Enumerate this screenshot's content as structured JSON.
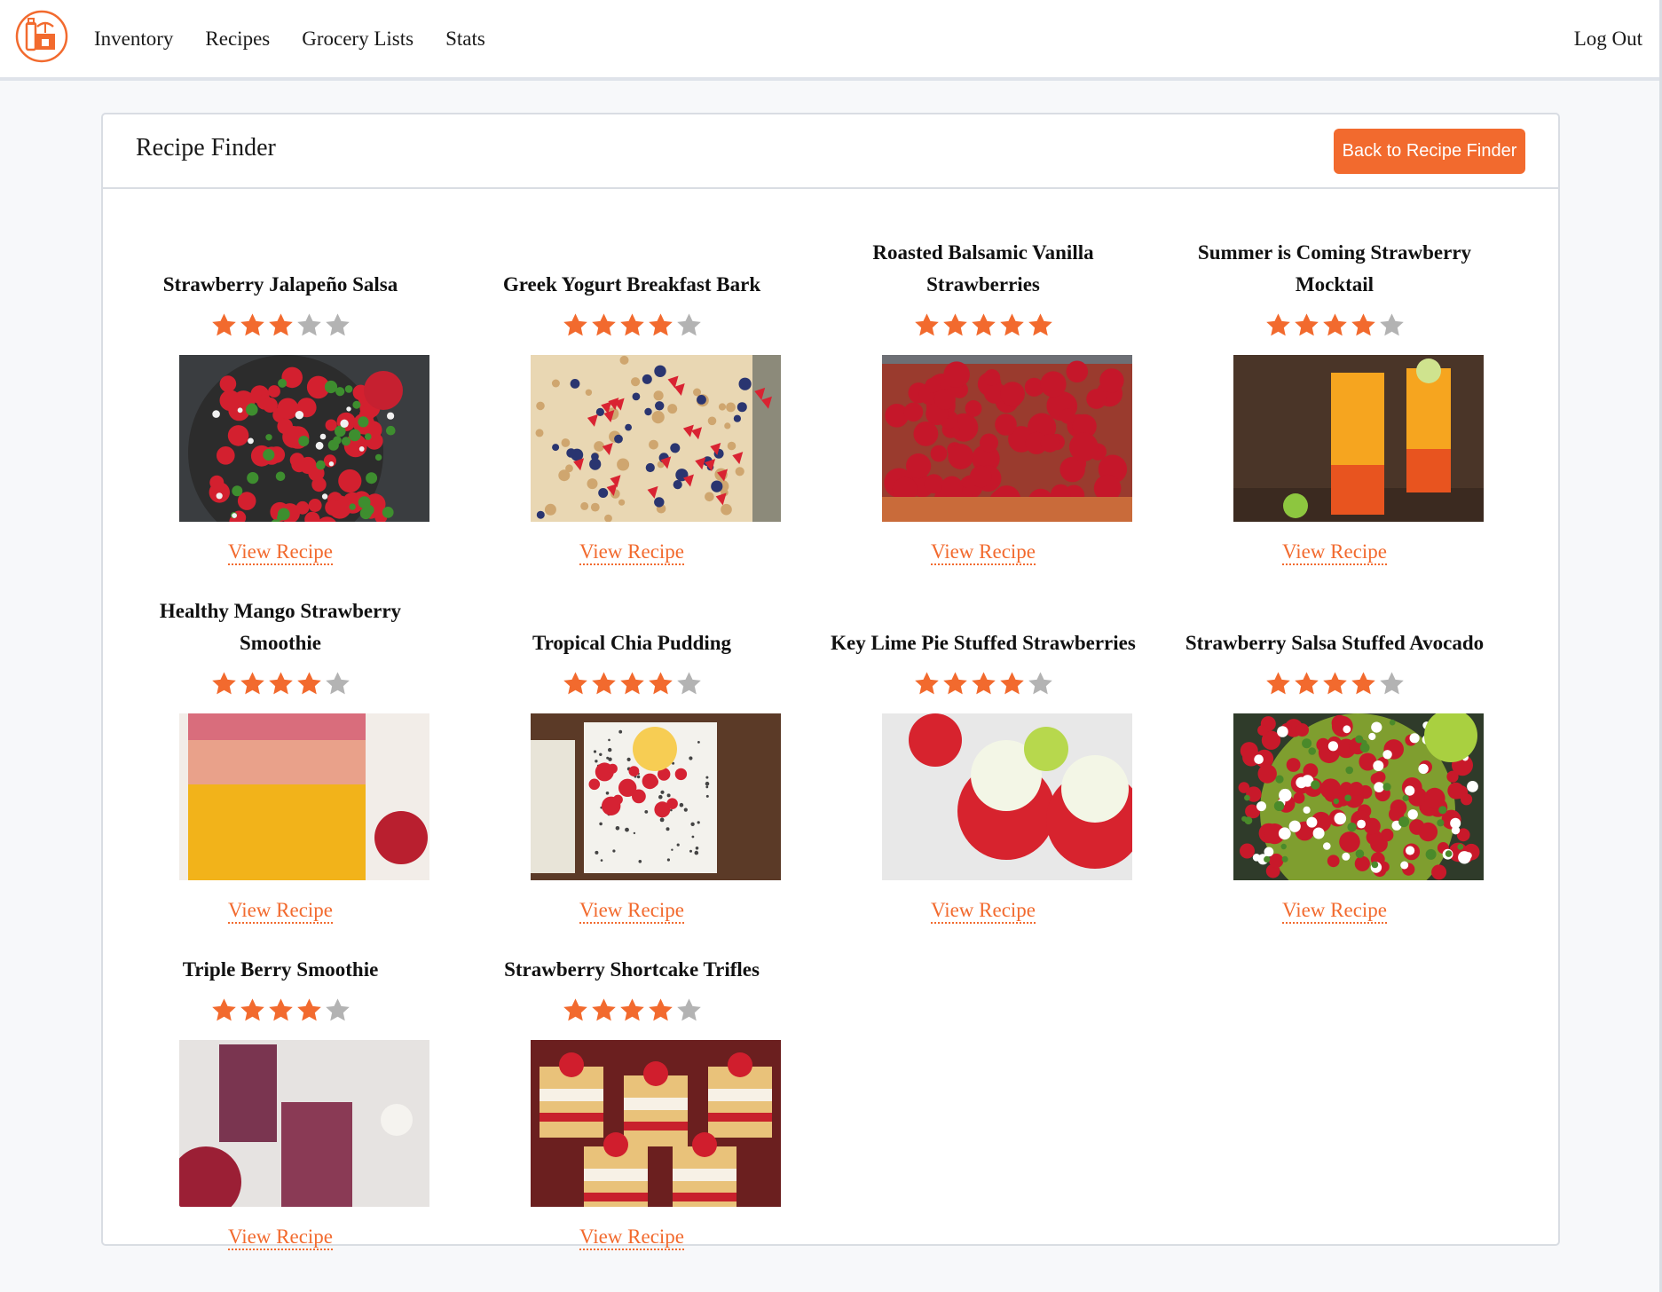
{
  "nav": {
    "logo_icon": "kitchen-pantry-logo-icon",
    "links": [
      "Inventory",
      "Recipes",
      "Grocery Lists",
      "Stats"
    ],
    "logout": "Log Out"
  },
  "card": {
    "title": "Recipe Finder",
    "back_button": "Back to Recipe Finder"
  },
  "colors": {
    "accent": "#f26a2e",
    "star_empty": "#b3b3b3"
  },
  "recipes": [
    {
      "title": "Strawberry Jalapeño Salsa",
      "rating": 3,
      "image": "strawberry-salsa-bowl-photo",
      "link": "View Recipe"
    },
    {
      "title": "Greek Yogurt Breakfast Bark",
      "rating": 4,
      "image": "yogurt-bark-photo",
      "link": "View Recipe"
    },
    {
      "title": "Roasted Balsamic Vanilla Strawberries",
      "rating": 5,
      "image": "roasted-strawberries-tray-photo",
      "link": "View Recipe"
    },
    {
      "title": "Summer is Coming Strawberry Mocktail",
      "rating": 4,
      "image": "mocktail-glasses-photo",
      "link": "View Recipe"
    },
    {
      "title": "Healthy Mango Strawberry Smoothie",
      "rating": 4,
      "image": "mango-smoothie-jar-photo",
      "link": "View Recipe"
    },
    {
      "title": "Tropical Chia Pudding",
      "rating": 4,
      "image": "chia-pudding-cups-photo",
      "link": "View Recipe"
    },
    {
      "title": "Key Lime Pie Stuffed Strawberries",
      "rating": 4,
      "image": "stuffed-strawberries-photo",
      "link": "View Recipe"
    },
    {
      "title": "Strawberry Salsa Stuffed Avocado",
      "rating": 4,
      "image": "stuffed-avocado-photo",
      "link": "View Recipe"
    },
    {
      "title": "Triple Berry Smoothie",
      "rating": 4,
      "image": "berry-smoothie-glasses-photo",
      "link": "View Recipe"
    },
    {
      "title": "Strawberry Shortcake Trifles",
      "rating": 4,
      "image": "shortcake-trifle-jars-photo",
      "link": "View Recipe"
    }
  ]
}
